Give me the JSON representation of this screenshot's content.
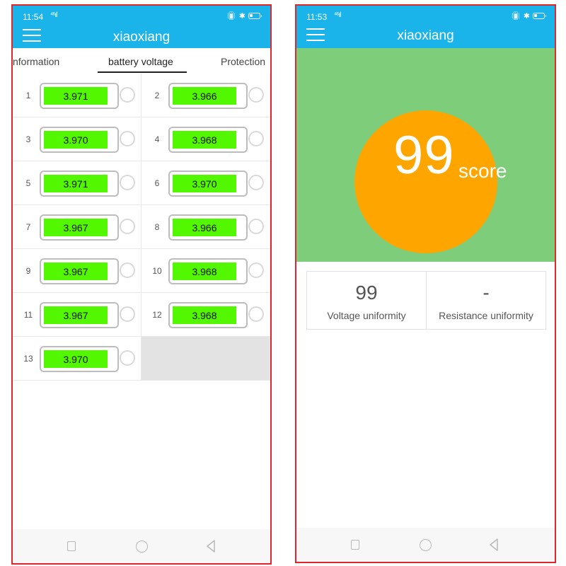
{
  "left_screen": {
    "status": {
      "time": "11:54",
      "signal": "⁴⁶ıl"
    },
    "app_title": "xiaoxiang",
    "tabs": [
      {
        "label": "nformation",
        "active": false
      },
      {
        "label": "battery voltage",
        "active": true
      },
      {
        "label": "Protection",
        "active": false
      }
    ],
    "cells": [
      {
        "index": "1",
        "voltage": "3.971"
      },
      {
        "index": "2",
        "voltage": "3.966"
      },
      {
        "index": "3",
        "voltage": "3.970"
      },
      {
        "index": "4",
        "voltage": "3.968"
      },
      {
        "index": "5",
        "voltage": "3.971"
      },
      {
        "index": "6",
        "voltage": "3.970"
      },
      {
        "index": "7",
        "voltage": "3.967"
      },
      {
        "index": "8",
        "voltage": "3.966"
      },
      {
        "index": "9",
        "voltage": "3.967"
      },
      {
        "index": "10",
        "voltage": "3.968"
      },
      {
        "index": "11",
        "voltage": "3.967"
      },
      {
        "index": "12",
        "voltage": "3.968"
      },
      {
        "index": "13",
        "voltage": "3.970"
      }
    ]
  },
  "right_screen": {
    "status": {
      "time": "11:53",
      "signal": "⁴⁶ıl"
    },
    "app_title": "xiaoxiang",
    "score": {
      "value": "99",
      "unit": "score"
    },
    "metrics": [
      {
        "value": "99",
        "label": "Voltage uniformity"
      },
      {
        "value": "-",
        "label": "Resistance uniformity"
      }
    ]
  },
  "status_icons": [
    "vibrate-icon",
    "bluetooth-icon",
    "battery-icon"
  ],
  "nav_icons": [
    "recent-apps-icon",
    "home-icon",
    "back-icon"
  ],
  "colors": {
    "app_bar": "#1ab3ea",
    "cell_fill": "#52f700",
    "score_bg": "#7dcd7a",
    "score_circle": "#fea500",
    "frame": "#e0252b"
  }
}
